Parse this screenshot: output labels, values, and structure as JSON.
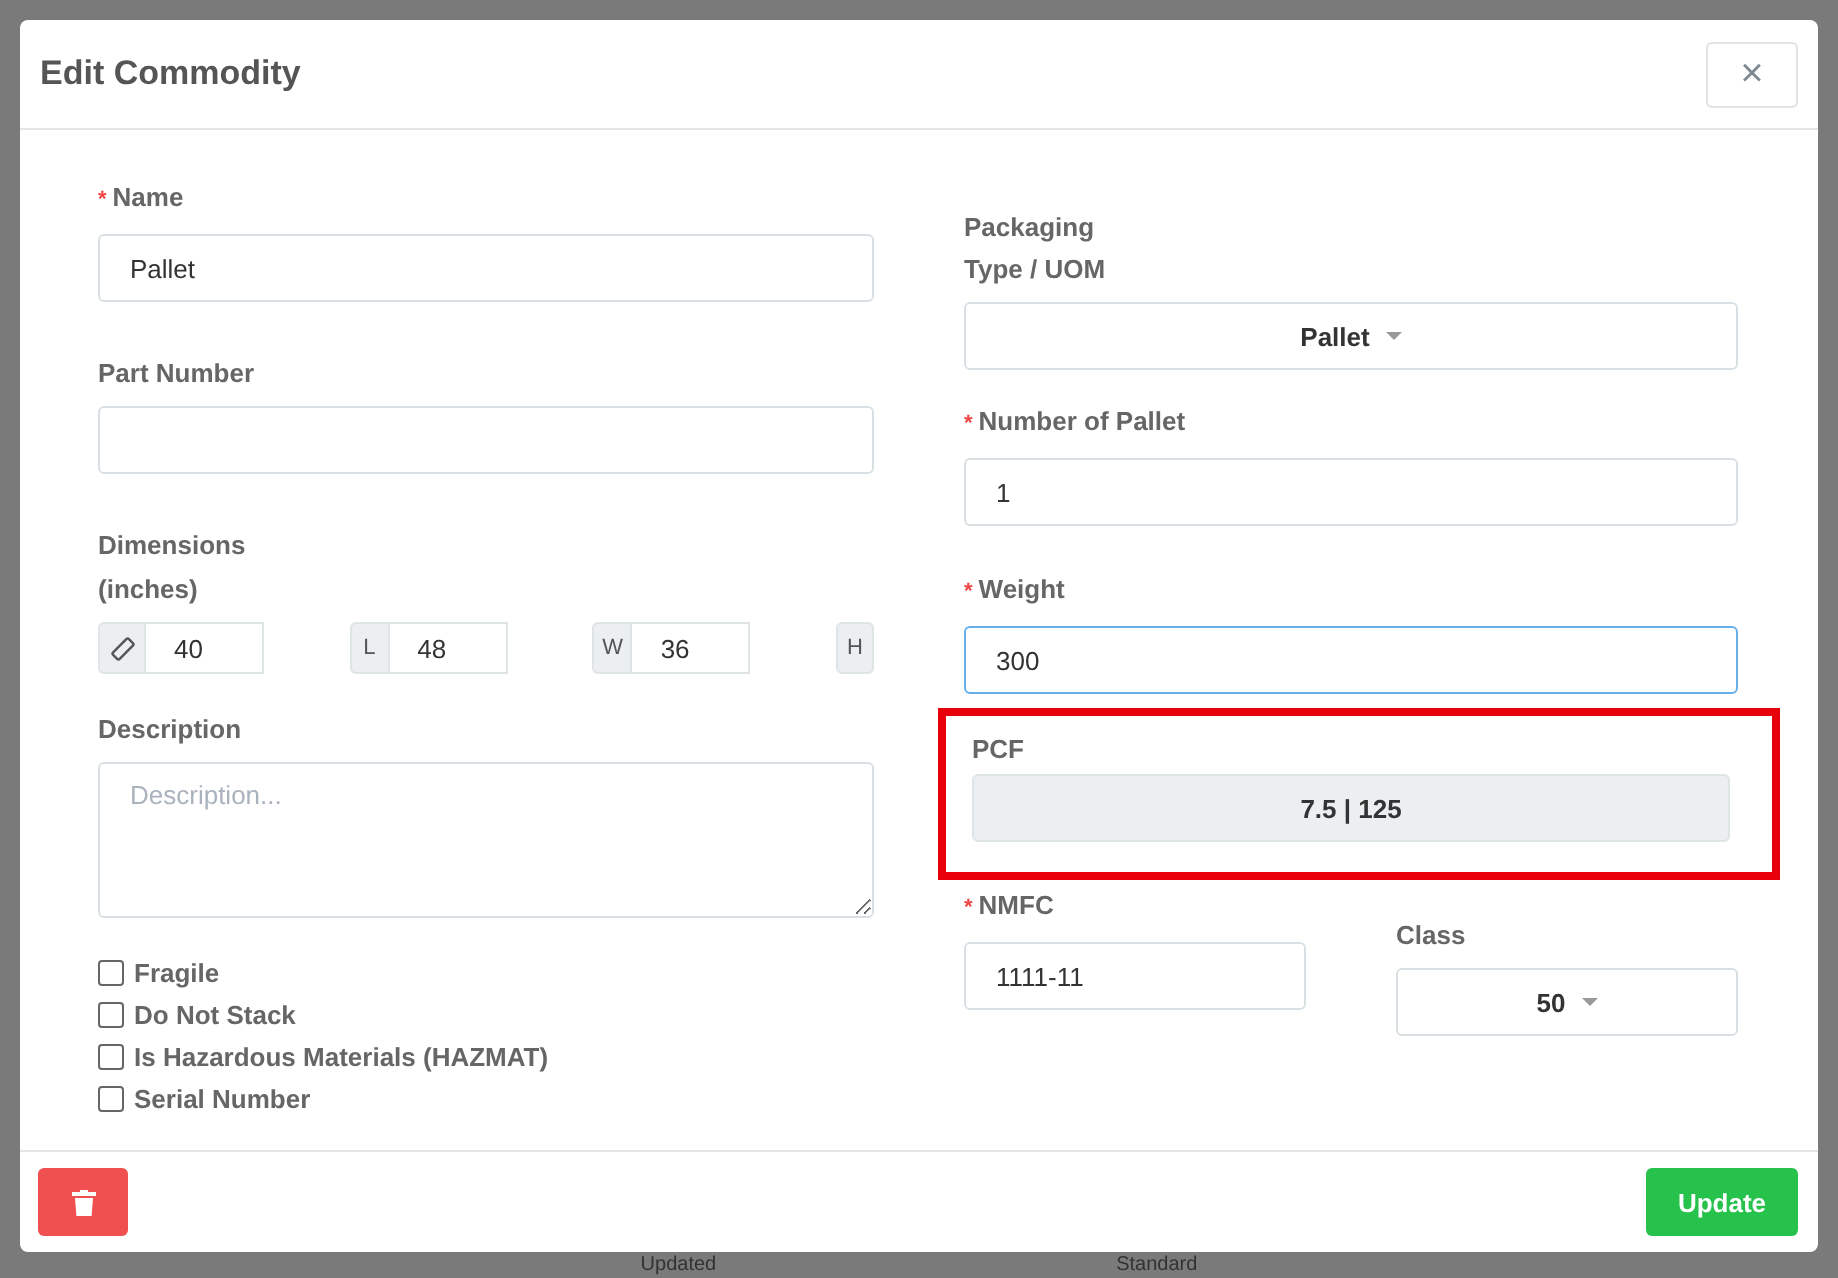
{
  "dialog": {
    "title": "Edit Commodity",
    "close_glyph": "×"
  },
  "left": {
    "name": {
      "label": "Name",
      "marker": "*",
      "value": "Pallet"
    },
    "part_number": {
      "label": "Part Number"
    },
    "dimensions": {
      "label": "Dimensions",
      "unit": "(inches)",
      "fields": [
        {
          "kind": "icon",
          "value": "40"
        },
        {
          "kind": "letter",
          "addon": "L",
          "value": "48"
        },
        {
          "kind": "letter",
          "addon": "W",
          "value": "36"
        },
        {
          "kind": "addon_only",
          "addon": "H"
        }
      ]
    },
    "description": {
      "label": "Description",
      "placeholder": "Description..."
    },
    "checkboxes": [
      {
        "label": "Fragile",
        "checked": false
      },
      {
        "label": "Do Not Stack",
        "checked": false
      },
      {
        "label": "Is Hazardous Materials (HAZMAT)",
        "checked": false
      },
      {
        "label": "Serial Number",
        "checked": false
      }
    ]
  },
  "right": {
    "packaging": {
      "label_lines": [
        "Packaging",
        "Type / UOM"
      ],
      "value": "Pallet"
    },
    "count": {
      "label": "Number of Pallet",
      "marker": "*",
      "value": "1"
    },
    "weight": {
      "label": "Weight",
      "marker": "*",
      "value": "300",
      "focused": true
    },
    "pcf": {
      "label": "PCF",
      "value": "7.5 | 125",
      "highlighted": true
    },
    "nmfc": {
      "label": "NMFC",
      "marker": "*",
      "value": "1111-11"
    },
    "class": {
      "label": "Class",
      "value": "50"
    }
  },
  "footer": {
    "update_button": "Update"
  },
  "backdrop": {
    "texts": [
      "Updated",
      "Standard"
    ]
  }
}
